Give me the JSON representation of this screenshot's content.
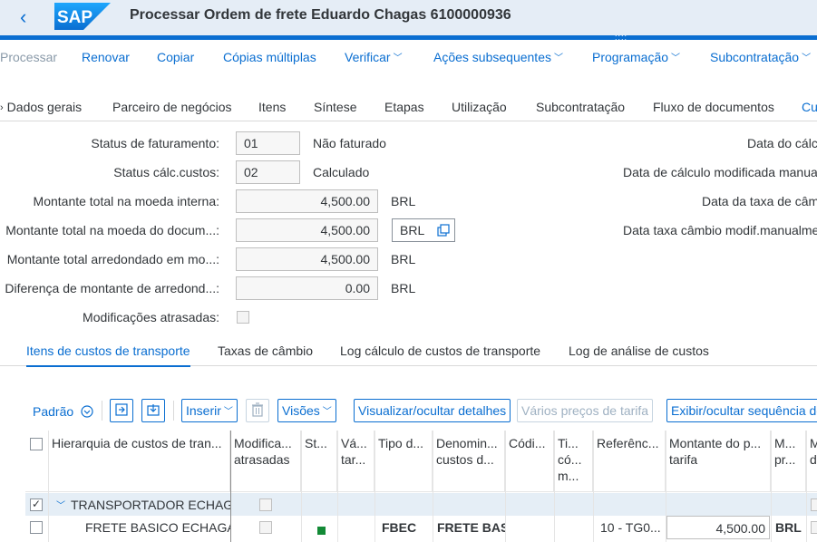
{
  "shell": {
    "back": "‹",
    "logo": "SAP",
    "title": "Processar Ordem de frete Eduardo Chagas 6100000936",
    "grip": "::::"
  },
  "toolbar": {
    "processar": "Processar",
    "renovar": "Renovar",
    "copiar": "Copiar",
    "copias_multiplas": "Cópias múltiplas",
    "verificar": "Verificar",
    "acoes_subsequentes": "Ações subsequentes",
    "programacao": "Programação",
    "subcontratacao": "Subcontratação",
    "chevron": "﹀"
  },
  "tabs": {
    "dados_gerais": "Dados gerais",
    "parceiro": "Parceiro de negócios",
    "itens": "Itens",
    "sintese": "Síntese",
    "etapas": "Etapas",
    "utilizacao": "Utilização",
    "subcontratacao": "Subcontratação",
    "fluxo": "Fluxo de documentos",
    "custos": "Cu"
  },
  "form": {
    "status_faturamento": {
      "label": "Status de faturamento:",
      "value": "01",
      "text": "Não faturado"
    },
    "status_calc": {
      "label": "Status cálc.custos:",
      "value": "02",
      "text": "Calculado"
    },
    "montante_interna": {
      "label": "Montante total na moeda interna:",
      "value": "4,500.00",
      "currency": "BRL"
    },
    "montante_docum": {
      "label": "Montante total na moeda do docum...:",
      "value": "4,500.00",
      "currency": "BRL"
    },
    "montante_arred": {
      "label": "Montante total arredondado em mo...:",
      "value": "4,500.00",
      "currency": "BRL"
    },
    "diferenca": {
      "label": "Diferença de montante de arredond...:",
      "value": "0.00",
      "currency": "BRL"
    },
    "modificacoes": {
      "label": "Modificações atrasadas:"
    },
    "right": {
      "data_calc": "Data do cálc",
      "data_calc_mod": "Data de cálculo modificada manua",
      "data_taxa": "Data da taxa de câm",
      "data_taxa_mod": "Data taxa câmbio modif.manualme"
    }
  },
  "subtabs": {
    "itens_custos": "Itens de custos de transporte",
    "taxas": "Taxas de câmbio",
    "log_calculo": "Log cálculo de custos de transporte",
    "log_analise": "Log de análise de custos"
  },
  "gridtoolbar": {
    "padrao": "Padrão",
    "inserir": "Inserir",
    "visoes": "Visões",
    "visualizar": "Visualizar/ocultar detalhes",
    "varios_precos": "Vários preços de tarifa",
    "exibir": "Exibir/ocultar sequência de"
  },
  "table": {
    "headers": {
      "hierarquia": "Hierarquia de custos de tran...",
      "modifica": "Modifica... atrasadas",
      "status": "St...",
      "valido": "Vá... tar...",
      "tipo": "Tipo d...",
      "denominacao": "Denomin... custos d...",
      "codigo": "Códi...",
      "tipo_codigo": "Ti... có... m...",
      "referencia": "Referênc...",
      "montante": "Montante do p... tarifa",
      "moeda": "M... pr...",
      "extra": "M... d..."
    },
    "rows": [
      {
        "hierarquia": "TRANSPORTADOR ECHAGAS",
        "expander": "﹀",
        "selected": true
      },
      {
        "hierarquia": "FRETE BASICO ECHAGAS",
        "tipo": "FBEC",
        "denominacao": "FRETE BASICO",
        "referencia": "10 - TG0...",
        "montante": "4,500.00",
        "moeda": "BRL",
        "status_color": "#138a36"
      }
    ]
  }
}
